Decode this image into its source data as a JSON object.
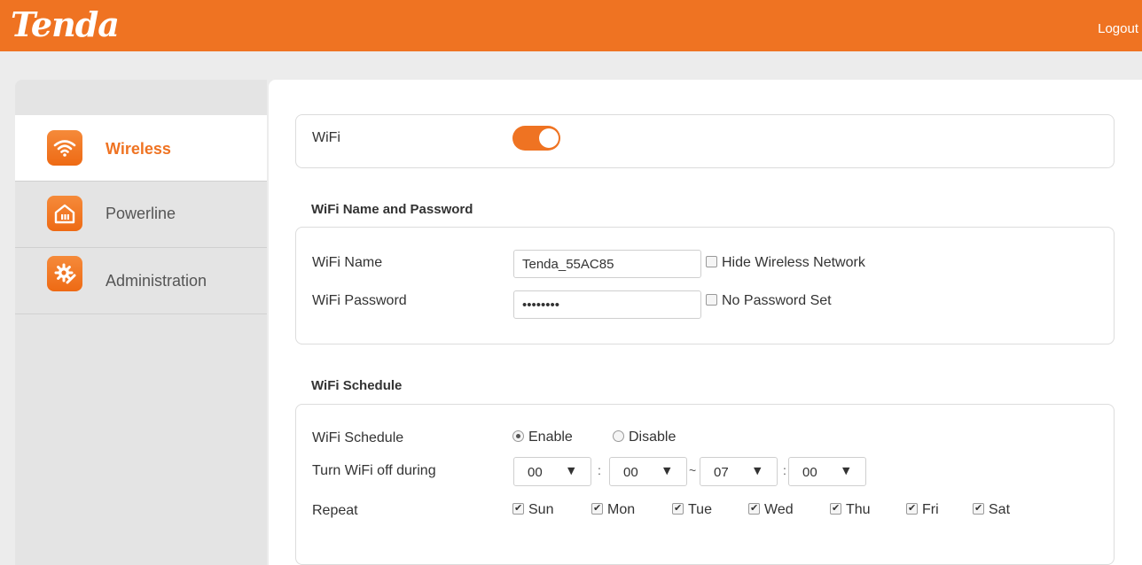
{
  "header": {
    "logo": "Tenda",
    "logout": "Logout"
  },
  "sidebar": {
    "items": [
      {
        "label": "Wireless",
        "icon": "wifi-icon",
        "active": true
      },
      {
        "label": "Powerline",
        "icon": "home-icon",
        "active": false
      },
      {
        "label": "Administration",
        "icon": "gear-icon",
        "active": false
      }
    ]
  },
  "wifi": {
    "label": "WiFi",
    "enabled": true
  },
  "name_password": {
    "title": "WiFi Name and Password",
    "name_label": "WiFi Name",
    "name_value": "Tenda_55AC85",
    "hide_label": "Hide Wireless Network",
    "password_label": "WiFi Password",
    "password_value": "••••••••",
    "nopass_label": "No Password Set"
  },
  "schedule": {
    "title": "WiFi Schedule",
    "label": "WiFi Schedule",
    "enable": "Enable",
    "disable": "Disable",
    "selected": "Enable",
    "off_label": "Turn WiFi off during",
    "start_hour": "00",
    "start_min": "00",
    "range_sep": "~",
    "end_hour": "07",
    "end_min": "00",
    "time_sep": ":",
    "repeat_label": "Repeat",
    "days": [
      "Sun",
      "Mon",
      "Tue",
      "Wed",
      "Thu",
      "Fri",
      "Sat"
    ]
  },
  "colors": {
    "accent": "#ef7322",
    "background": "#ececec"
  }
}
